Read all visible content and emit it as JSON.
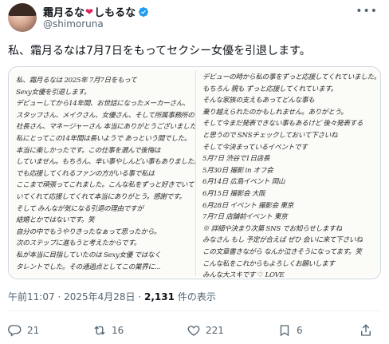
{
  "header": {
    "display_name": "霜月るな",
    "display_name_suffix": "しもるな",
    "heart": "❤",
    "handle": "@shimoruna",
    "more": "•••"
  },
  "tweet": {
    "text": "私、霜月るなは7月7日をもってセクシー女優を引退します。"
  },
  "letter": {
    "left_lines": [
      "私、霜月るなは 2025年 7月7日をもって",
      "Sexy女優を引退します。",
      "デビューしてから14年間、お世話になったメーカーさん、",
      "スタッフさん、メイクさん、女優さん、そして所属事務所の",
      "社長さん、マネージャーさん 本当にありがとうございました。",
      "私にとってこの14年間は長いようで あっという間でした。",
      "本当に楽しかったです。この仕事を選んで後悔は",
      "していません。もちろん、辛い事やしんどい事もありました。",
      "でも応援してくれるファンの方がいる事で私は",
      "ここまで頑張ってこれました。こんな私をずっと好きでいて",
      "いてくれて応援してくれて本当にありがとう。感謝です。",
      "そして みんなが気になる引退の理由ですが",
      "結婚とかではないです。笑",
      "自分の中でもうやりきったなぁって思ったから。",
      "次のステップに進もうと考えたからです。",
      "私が本当に目指していたのは Sexy女優 ではなく",
      "タレントでした。その通過点としてこの業界に..."
    ],
    "right_lines": [
      "デビューの時から私の事をずっと応援してくれていました。",
      "もちろん 親も ずっと応援してくれています。",
      "そんな家族の支えもあってどんな事も",
      "乗り越えられたのかもしれません。ありがとう。",
      "そして今まだ発表できない事もあるけど 後々発表する",
      "と思うので SNSチェックしておいて下さいね",
      "そして今決まっているイベントです",
      "5月7日 渋谷で1日店長",
      "5月30日 撮影 in オフ会",
      "6月14日 広島イベント 岡山",
      "6月15日 撮影会 大阪",
      "6月28日 イベント 撮影会 東京",
      "7月7日 店舗前イベント 東京",
      "※ 詳細や決まり次第 SNS でお知らせしますね",
      "みなさん もし 予定が合えば ぜひ 会いに来て下さいね",
      "この文章書きながら なんか泣きそうになってます。笑",
      "こんな私をこれからもよろしくお願いします",
      "みんな大スキです ♡ LOVE"
    ]
  },
  "meta": {
    "time": "午前11:07",
    "separator": "·",
    "date": "2025年4月28日",
    "views_count": "2,131",
    "views_label": "件の表示"
  },
  "actions": {
    "reply_count": "21",
    "retweet_count": "16",
    "like_count": "221",
    "bookmark_count": "6"
  },
  "colors": {
    "accent": "#1d9bf0",
    "heart": "#e0245e",
    "muted": "#536471"
  }
}
